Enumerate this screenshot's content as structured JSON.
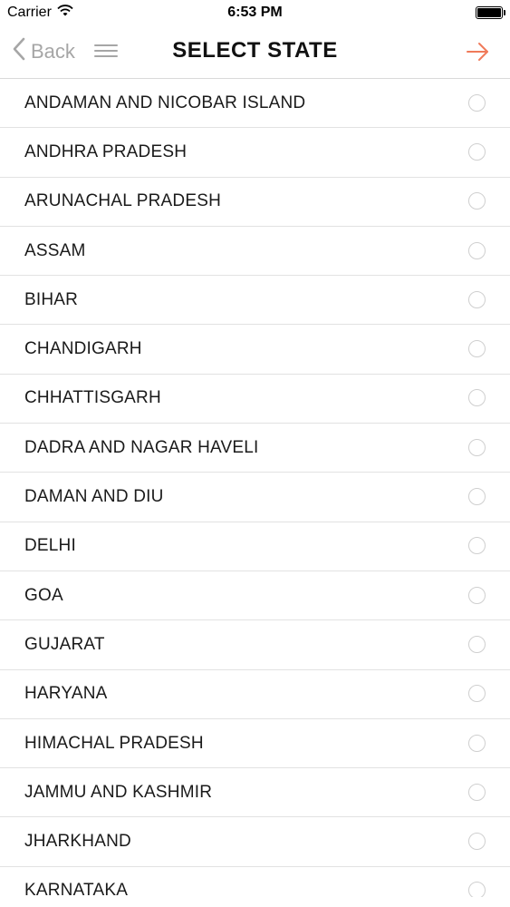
{
  "status_bar": {
    "carrier": "Carrier",
    "time": "6:53 PM"
  },
  "nav": {
    "back_label": "Back",
    "title": "SELECT STATE",
    "accent_color": "#f07a5a",
    "muted_color": "#a6a6a6"
  },
  "states": [
    {
      "name": "ANDAMAN AND NICOBAR ISLAND",
      "selected": false
    },
    {
      "name": "ANDHRA PRADESH",
      "selected": false
    },
    {
      "name": "ARUNACHAL PRADESH",
      "selected": false
    },
    {
      "name": "ASSAM",
      "selected": false
    },
    {
      "name": "BIHAR",
      "selected": false
    },
    {
      "name": "CHANDIGARH",
      "selected": false
    },
    {
      "name": "CHHATTISGARH",
      "selected": false
    },
    {
      "name": "DADRA AND NAGAR HAVELI",
      "selected": false
    },
    {
      "name": "DAMAN AND DIU",
      "selected": false
    },
    {
      "name": "DELHI",
      "selected": false
    },
    {
      "name": "GOA",
      "selected": false
    },
    {
      "name": "GUJARAT",
      "selected": false
    },
    {
      "name": "HARYANA",
      "selected": false
    },
    {
      "name": "HIMACHAL PRADESH",
      "selected": false
    },
    {
      "name": "JAMMU AND KASHMIR",
      "selected": false
    },
    {
      "name": "JHARKHAND",
      "selected": false
    },
    {
      "name": "KARNATAKA",
      "selected": false
    }
  ]
}
